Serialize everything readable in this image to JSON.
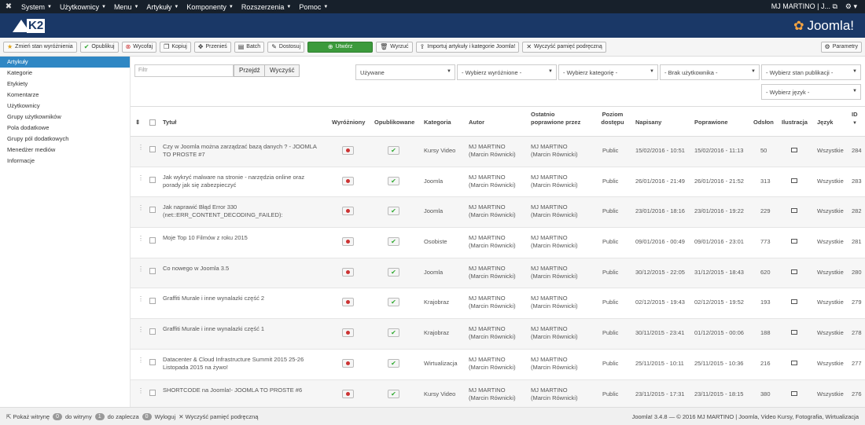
{
  "topbar": {
    "menu": [
      "System",
      "Użytkownicy",
      "Menu",
      "Artykuły",
      "Komponenty",
      "Rozszerzenia",
      "Pomoc"
    ],
    "user": "MJ MARTINO | J..."
  },
  "header": {
    "logo": "K2",
    "brand": "Joomla!"
  },
  "toolbar": {
    "buttons": [
      "Zmień stan wyróżnienia",
      "Opublikuj",
      "Wycofaj",
      "Kopiuj",
      "Przenieś",
      "Batch",
      "Dostosuj",
      "Utwórz",
      "Wyrzuć",
      "Importuj artykuły i kategorie Joomla!",
      "Wyczyść pamięć podręczną"
    ],
    "params": "Parametry"
  },
  "sidebar": [
    "Artykuły",
    "Kategorie",
    "Etykiety",
    "Komentarze",
    "Użytkownicy",
    "Grupy użytkowników",
    "Pola dodatkowe",
    "Grupy pól dodatkowych",
    "Menedżer mediów",
    "Informacje"
  ],
  "filters": {
    "placeholder": "Filtr",
    "go": "Przejdź",
    "clear": "Wyczyść",
    "selects": [
      "Używane",
      "- Wybierz wyróżnione -",
      "- Wybierz kategorię -",
      "- Brak użytkownika -",
      "- Wybierz stan publikacji -",
      "- Wybierz język -"
    ]
  },
  "columns": {
    "title": "Tytuł",
    "featured": "Wyróżniony",
    "published": "Opublikowane",
    "category": "Kategoria",
    "author": "Autor",
    "modby": "Ostatnio poprawione przez",
    "access": "Poziom dostępu",
    "created": "Napisany",
    "modified": "Poprawione",
    "hits": "Odsłon",
    "image": "Ilustracja",
    "lang": "Język",
    "id": "ID"
  },
  "rows": [
    {
      "title": "Czy w Joomla można zarządzać bazą danych ? - JOOMLA TO PROSTE #7",
      "cat": "Kursy Video",
      "author": "MJ MARTINO (Marcin Równicki)",
      "mod": "MJ MARTINO (Marcin Równicki)",
      "access": "Public",
      "created": "15/02/2016 - 10:51",
      "modified": "15/02/2016 - 11:13",
      "hits": "50",
      "lang": "Wszystkie",
      "id": "284"
    },
    {
      "title": "Jak wykryć malware na stronie - narzędzia online oraz porady jak się zabezpieczyć",
      "cat": "Joomla",
      "author": "MJ MARTINO (Marcin Równicki)",
      "mod": "MJ MARTINO (Marcin Równicki)",
      "access": "Public",
      "created": "26/01/2016 - 21:49",
      "modified": "26/01/2016 - 21:52",
      "hits": "313",
      "lang": "Wszystkie",
      "id": "283"
    },
    {
      "title": "Jak naprawić Błąd Error 330 (net::ERR_CONTENT_DECODING_FAILED):",
      "cat": "Joomla",
      "author": "MJ MARTINO (Marcin Równicki)",
      "mod": "MJ MARTINO (Marcin Równicki)",
      "access": "Public",
      "created": "23/01/2016 - 18:16",
      "modified": "23/01/2016 - 19:22",
      "hits": "229",
      "lang": "Wszystkie",
      "id": "282"
    },
    {
      "title": "Moje Top 10 Filmów z roku 2015",
      "cat": "Osobiste",
      "author": "MJ MARTINO (Marcin Równicki)",
      "mod": "MJ MARTINO (Marcin Równicki)",
      "access": "Public",
      "created": "09/01/2016 - 00:49",
      "modified": "09/01/2016 - 23:01",
      "hits": "773",
      "lang": "Wszystkie",
      "id": "281"
    },
    {
      "title": "Co nowego w Joomla 3.5",
      "cat": "Joomla",
      "author": "MJ MARTINO (Marcin Równicki)",
      "mod": "MJ MARTINO (Marcin Równicki)",
      "access": "Public",
      "created": "30/12/2015 - 22:05",
      "modified": "31/12/2015 - 18:43",
      "hits": "620",
      "lang": "Wszystkie",
      "id": "280"
    },
    {
      "title": "Graffiti Murale i inne wynalazki część 2",
      "cat": "Krajobraz",
      "author": "MJ MARTINO (Marcin Równicki)",
      "mod": "MJ MARTINO (Marcin Równicki)",
      "access": "Public",
      "created": "02/12/2015 - 19:43",
      "modified": "02/12/2015 - 19:52",
      "hits": "193",
      "lang": "Wszystkie",
      "id": "279"
    },
    {
      "title": "Graffiti Murale i inne wynalazki część 1",
      "cat": "Krajobraz",
      "author": "MJ MARTINO (Marcin Równicki)",
      "mod": "MJ MARTINO (Marcin Równicki)",
      "access": "Public",
      "created": "30/11/2015 - 23:41",
      "modified": "01/12/2015 - 00:06",
      "hits": "188",
      "lang": "Wszystkie",
      "id": "278"
    },
    {
      "title": "Datacenter & Cloud Infrastructure Summit 2015 25-26 Listopada 2015 na żywo!",
      "cat": "Wirtualizacja",
      "author": "MJ MARTINO (Marcin Równicki)",
      "mod": "MJ MARTINO (Marcin Równicki)",
      "access": "Public",
      "created": "25/11/2015 - 10:11",
      "modified": "25/11/2015 - 10:36",
      "hits": "216",
      "lang": "Wszystkie",
      "id": "277"
    },
    {
      "title": "SHORTCODE na Joomla!- JOOMLA TO PROSTE #6",
      "cat": "Kursy Video",
      "author": "MJ MARTINO (Marcin Równicki)",
      "mod": "MJ MARTINO (Marcin Równicki)",
      "access": "Public",
      "created": "23/11/2015 - 17:31",
      "modified": "23/11/2015 - 18:15",
      "hits": "380",
      "lang": "Wszystkie",
      "id": "276"
    }
  ],
  "footer": {
    "view_site": "Pokaż witrynę",
    "site_count": "0",
    "site_label": "do witryny",
    "admin_count": "1",
    "admin_label": "do zaplecza",
    "logout_count": "0",
    "logout": "Wyloguj",
    "clear": "Wyczyść pamięć podręczną",
    "copyright": "Joomla! 3.4.8 — © 2016 MJ MARTINO | Joomla, Video Kursy, Fotografia, Wirtualizacja"
  }
}
